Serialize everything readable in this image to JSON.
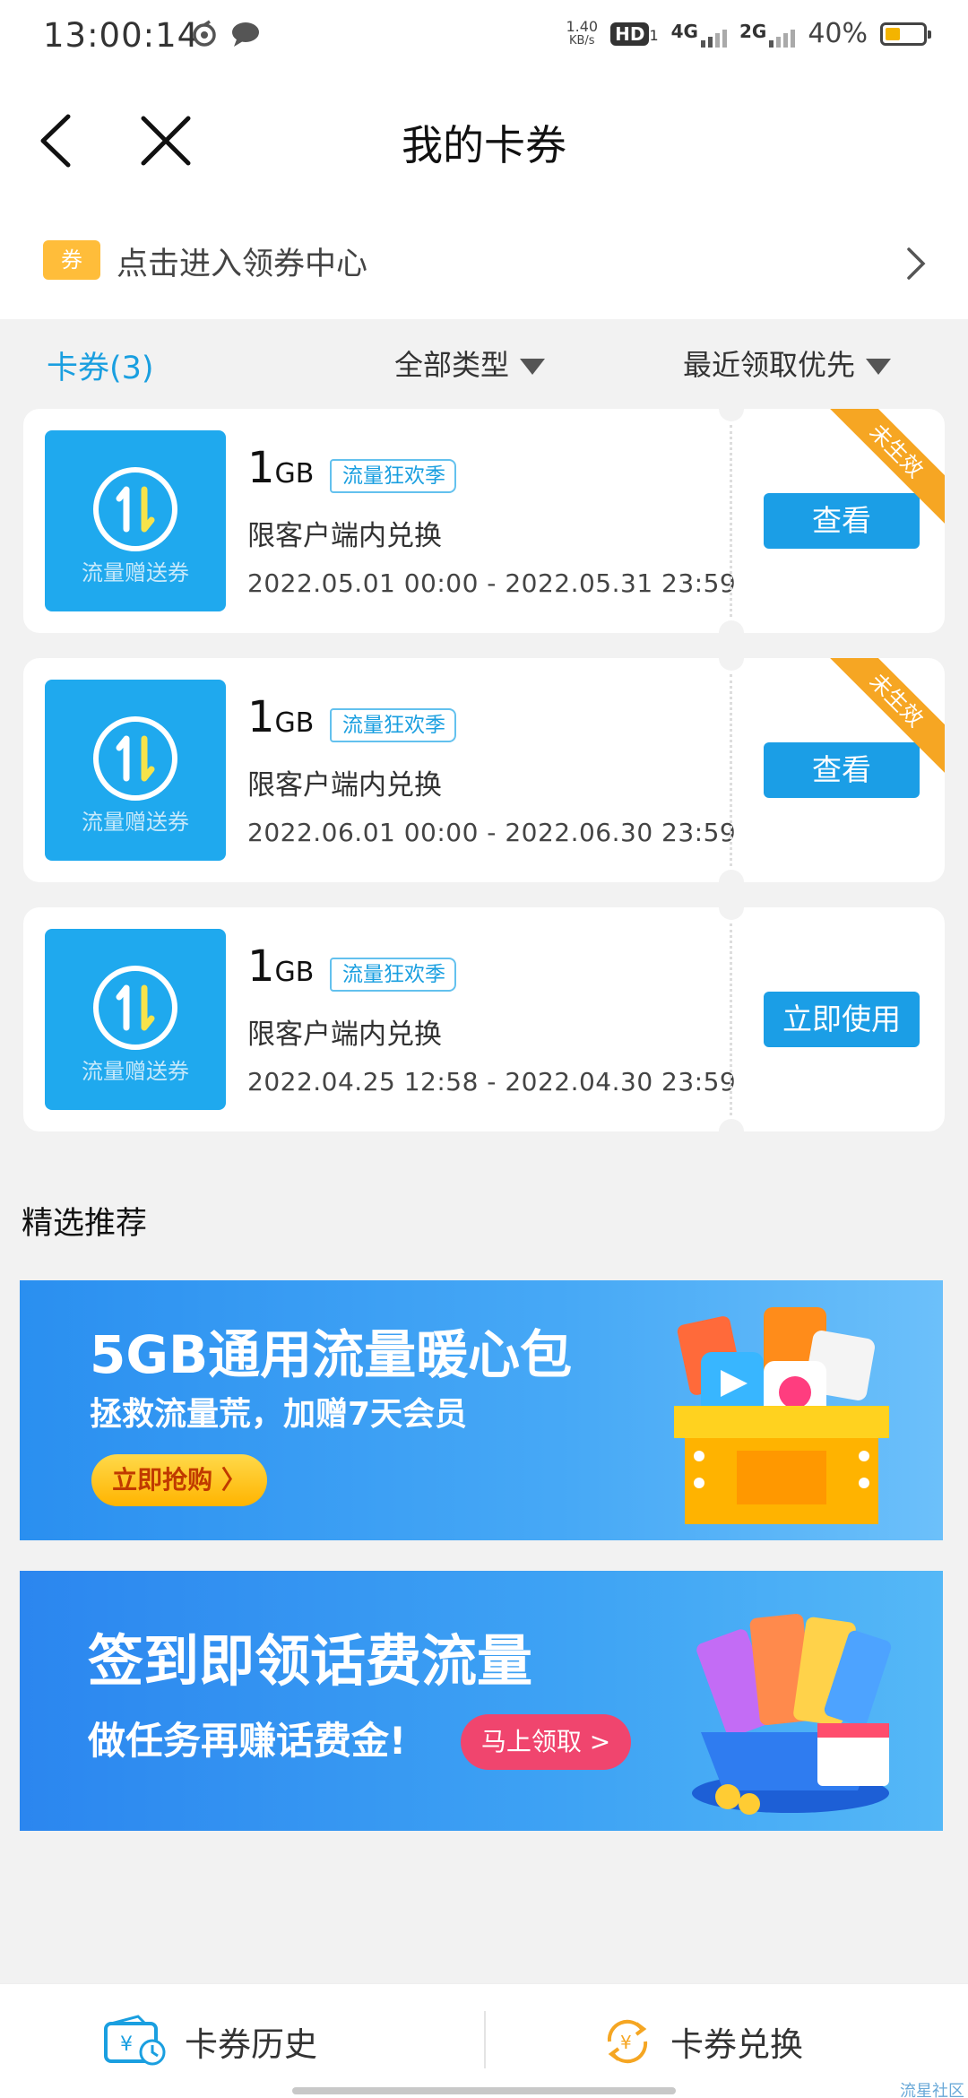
{
  "status_bar": {
    "time": "13:00:14",
    "net_speed_value": "1.40",
    "net_speed_unit": "KB/s",
    "hd": "HD",
    "hd_sub": "1",
    "signal_1": "4G",
    "signal_2": "2G",
    "battery": "40%",
    "battery_level": 0.4
  },
  "header": {
    "title": "我的卡券"
  },
  "coupon_center": {
    "badge": "券",
    "label": "点击进入领券中心"
  },
  "filters": {
    "count_label": "卡券(3)",
    "type_label": "全部类型",
    "sort_label": "最近领取优先"
  },
  "coupons": [
    {
      "icon_label": "流量赠送券",
      "amount": "1",
      "unit": "GB",
      "tag": "流量狂欢季",
      "desc": "限客户端内兑换",
      "date": "2022.05.01 00:00 - 2022.05.31 23:59",
      "button": "查看",
      "ribbon": "未生效"
    },
    {
      "icon_label": "流量赠送券",
      "amount": "1",
      "unit": "GB",
      "tag": "流量狂欢季",
      "desc": "限客户端内兑换",
      "date": "2022.06.01 00:00 - 2022.06.30 23:59",
      "button": "查看",
      "ribbon": "未生效"
    },
    {
      "icon_label": "流量赠送券",
      "amount": "1",
      "unit": "GB",
      "tag": "流量狂欢季",
      "desc": "限客户端内兑换",
      "date": "2022.04.25 12:58 - 2022.04.30 23:59",
      "button": "立即使用"
    }
  ],
  "recommend": {
    "title": "精选推荐",
    "banner1": {
      "title": "5GB通用流量暖心包",
      "subtitle": "拯救流量荒，加赠7天会员",
      "button": "立即抢购 〉"
    },
    "banner2": {
      "title": "签到即领话费流量",
      "subtitle": "做任务再赚话费金!",
      "button": "马上领取 >"
    }
  },
  "bottom_bar": {
    "history": "卡券历史",
    "exchange": "卡券兑换"
  },
  "watermark": "流星社区",
  "colors": {
    "accent": "#1a9fe0",
    "button": "#1b9ee6",
    "ribbon": "#f6a623",
    "badge": "#ffbd3a"
  }
}
